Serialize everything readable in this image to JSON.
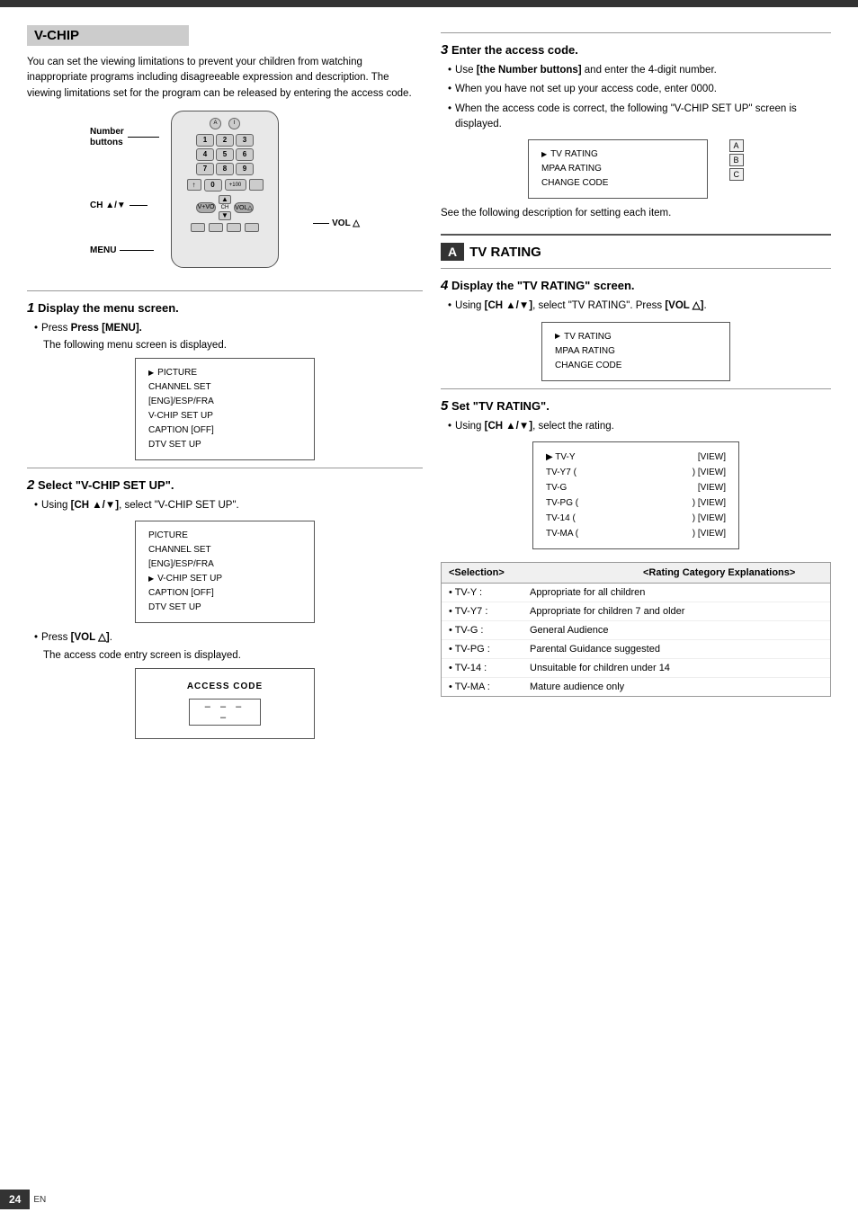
{
  "page": {
    "page_number": "24",
    "page_lang": "EN"
  },
  "vchip": {
    "section_title": "V-CHIP",
    "intro_text": "You can set the viewing limitations to prevent your children from watching inappropriate programs including disagreeable expression and description. The viewing limitations set for the program can be released by entering the access code.",
    "labels": {
      "number_buttons": "Number\nbuttons",
      "ch": "CH ▲/▼",
      "menu": "MENU",
      "vol": "VOL △"
    },
    "step1": {
      "num": "1",
      "title": "Display the menu screen.",
      "bullet1": "Press [MENU].",
      "bullet1_sub": "The following menu screen is displayed.",
      "menu_items": [
        "▶ PICTURE",
        "CHANNEL SET",
        "[ENG]/ESP/FRA",
        "V-CHIP SET UP",
        "CAPTION [OFF]",
        "DTV SET UP"
      ]
    },
    "step2": {
      "num": "2",
      "title": "Select \"V-CHIP SET UP\".",
      "bullet1": "Using [CH ▲/▼], select \"V-CHIP SET UP\".",
      "menu_items_selected": [
        "PICTURE",
        "CHANNEL SET",
        "[ENG]/ESP/FRA",
        "▶ V-CHIP SET UP",
        "CAPTION [OFF]",
        "DTV SET UP"
      ],
      "bullet2": "Press [VOL △].",
      "bullet2_sub": "The access code entry screen is displayed.",
      "access_code_label": "ACCESS CODE",
      "access_code_value": "– – – –"
    }
  },
  "step3": {
    "num": "3",
    "title": "Enter the access code.",
    "bullet1": "Use [the Number buttons] and enter the 4-digit number.",
    "bullet2": "When you have not set up your access code, enter 0000.",
    "bullet3": "When the access code is correct, the following \"V-CHIP SET UP\" screen is displayed.",
    "chip_menu": {
      "items": [
        "▶ TV RATING",
        "MPAA RATING",
        "CHANGE CODE"
      ],
      "side_a": "A",
      "side_b": "B",
      "side_c": "C"
    },
    "after_text": "See the following description for setting each item."
  },
  "tv_rating": {
    "section_label": "A",
    "section_title": "TV RATING",
    "step4": {
      "num": "4",
      "title": "Display the \"TV RATING\" screen.",
      "bullet1": "Using [CH ▲/▼], select \"TV RATING\". Press [VOL △].",
      "menu_items": [
        "▶ TV RATING",
        "MPAA RATING",
        "CHANGE CODE"
      ]
    },
    "step5": {
      "num": "5",
      "title": "Set \"TV RATING\".",
      "bullet1": "Using [CH ▲/▼], select the rating.",
      "rating_rows": [
        {
          "label": "▶ TV-Y",
          "value": "[VIEW]"
        },
        {
          "label": "TV-Y7 (",
          "value": ") [VIEW]"
        },
        {
          "label": "TV-G",
          "value": "[VIEW]"
        },
        {
          "label": "TV-PG (",
          "value": ") [VIEW]"
        },
        {
          "label": "TV-14 (",
          "value": ") [VIEW]"
        },
        {
          "label": "TV-MA (",
          "value": ") [VIEW]"
        }
      ]
    },
    "table": {
      "col1_header": "<Selection>",
      "col2_header": "<Rating Category Explanations>",
      "rows": [
        {
          "selection": "• TV-Y :",
          "explanation": "Appropriate for all children"
        },
        {
          "selection": "• TV-Y7 :",
          "explanation": "Appropriate for children 7 and older"
        },
        {
          "selection": "• TV-G :",
          "explanation": "General Audience"
        },
        {
          "selection": "• TV-PG :",
          "explanation": "Parental Guidance suggested"
        },
        {
          "selection": "• TV-14 :",
          "explanation": "Unsuitable for children under 14"
        },
        {
          "selection": "• TV-MA :",
          "explanation": "Mature audience only"
        }
      ]
    }
  }
}
